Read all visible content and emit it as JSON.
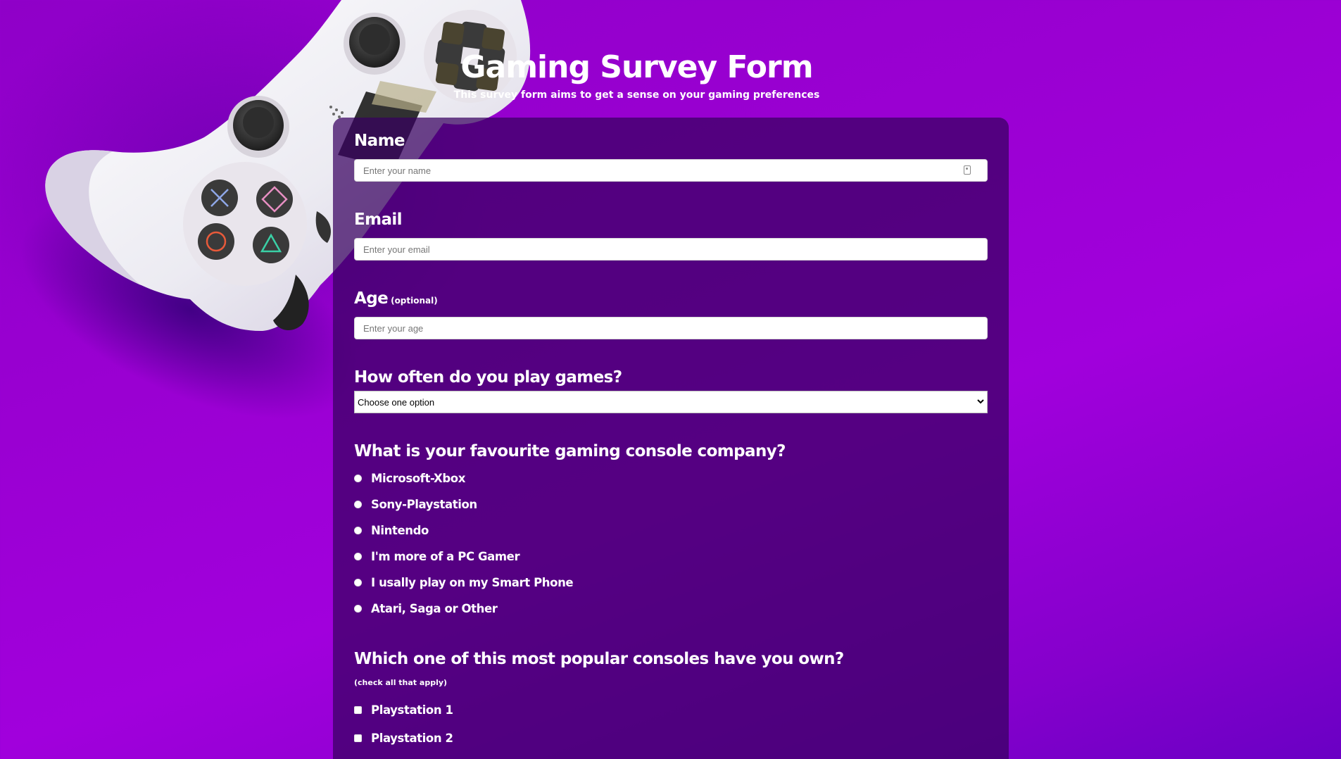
{
  "header": {
    "title": "Gaming Survey Form",
    "description": "This survey form aims to get a sense on your gaming preferences"
  },
  "form": {
    "name": {
      "label": "Name",
      "placeholder": "Enter your name"
    },
    "email": {
      "label": "Email",
      "placeholder": "Enter your email"
    },
    "age": {
      "label": "Age",
      "optional_note": "(optional)",
      "placeholder": "Enter your age"
    },
    "frequency": {
      "label": "How often do you play games?",
      "selected_option": "Choose one option"
    },
    "console_company": {
      "label": "What is your favourite gaming console company?",
      "options": [
        "Microsoft-Xbox",
        "Sony-Playstation",
        "Nintendo",
        "I'm more of a PC Gamer",
        "I usally play on my Smart Phone",
        "Atari, Saga or Other"
      ]
    },
    "consoles_owned": {
      "label": "Which one of this most popular consoles have you own?",
      "note": "(check all that apply)",
      "options": [
        "Playstation 1",
        "Playstation 2"
      ]
    }
  },
  "colors": {
    "background": "#9a00d2",
    "panel": "#3c0066",
    "text": "#ffffff"
  },
  "icons": {
    "input_autofill": "contact-card-icon",
    "select_arrow": "chevron-down-icon",
    "background_image": "game-controller"
  }
}
